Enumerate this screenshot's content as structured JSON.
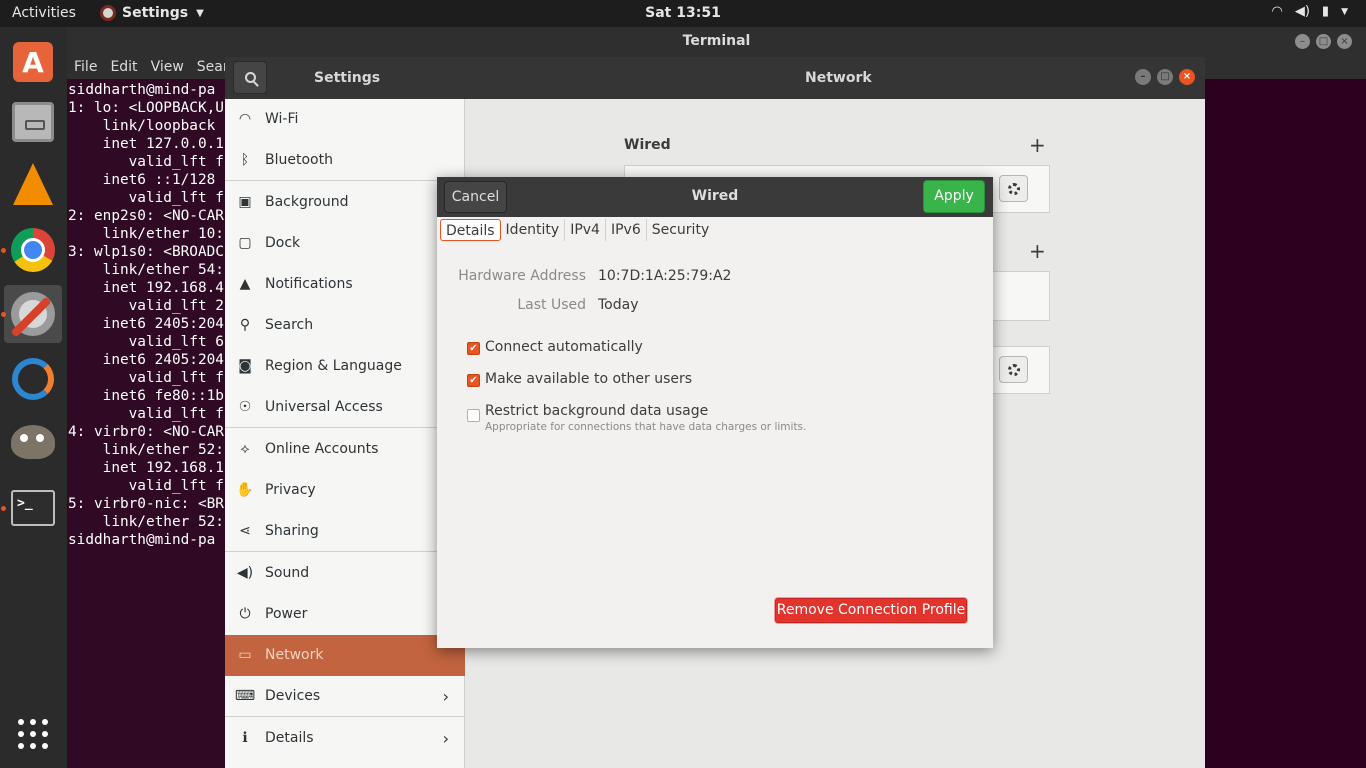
{
  "topbar": {
    "activities": "Activities",
    "app_menu": "Settings",
    "clock": "Sat 13:51",
    "icons": [
      "wifi-icon",
      "volume-icon",
      "battery-icon",
      "power-menu-icon"
    ]
  },
  "dock": {
    "apps": [
      "ubuntu-software",
      "files",
      "vlc",
      "chrome",
      "settings",
      "ring",
      "gimp",
      "terminal",
      "show-applications"
    ]
  },
  "terminal": {
    "title": "Terminal",
    "menu": [
      "File",
      "Edit",
      "View",
      "Searc"
    ],
    "lines": [
      "siddharth@mind-pa",
      "1: lo: <LOOPBACK,U",
      "    link/loopback",
      "    inet 127.0.0.1",
      "       valid_lft f",
      "    inet6 ::1/128",
      "       valid_lft f",
      "2: enp2s0: <NO-CAR",
      "    link/ether 10:",
      "3: wlp1s0: <BROADC",
      "    link/ether 54:",
      "    inet 192.168.4",
      "       valid_lft 2",
      "    inet6 2405:204",
      "       valid_lft 6",
      "    inet6 2405:204",
      "       valid_lft f",
      "    inet6 fe80::1b",
      "       valid_lft f",
      "4: virbr0: <NO-CAR",
      "    link/ether 52:",
      "    inet 192.168.1",
      "       valid_lft f",
      "5: virbr0-nic: <BR",
      "    link/ether 52:",
      "siddharth@mind-pa"
    ]
  },
  "settings": {
    "title_left": "Settings",
    "title_right": "Network",
    "sidebar": [
      {
        "label": "Wi-Fi",
        "icon": "wifi-icon"
      },
      {
        "label": "Bluetooth",
        "icon": "bluetooth-icon"
      },
      {
        "label": "Background",
        "icon": "background-icon"
      },
      {
        "label": "Dock",
        "icon": "dock-icon"
      },
      {
        "label": "Notifications",
        "icon": "bell-icon"
      },
      {
        "label": "Search",
        "icon": "search-icon"
      },
      {
        "label": "Region & Language",
        "icon": "camera-icon"
      },
      {
        "label": "Universal Access",
        "icon": "accessibility-icon"
      },
      {
        "label": "Online Accounts",
        "icon": "online-accounts-icon"
      },
      {
        "label": "Privacy",
        "icon": "hand-icon"
      },
      {
        "label": "Sharing",
        "icon": "share-icon"
      },
      {
        "label": "Sound",
        "icon": "speaker-icon"
      },
      {
        "label": "Power",
        "icon": "power-plug-icon"
      },
      {
        "label": "Network",
        "icon": "network-icon"
      },
      {
        "label": "Devices",
        "icon": "devices-icon"
      },
      {
        "label": "Details",
        "icon": "info-icon"
      }
    ],
    "network": {
      "wired_heading": "Wired"
    }
  },
  "dialog": {
    "title": "Wired",
    "cancel": "Cancel",
    "apply": "Apply",
    "tabs": [
      "Details",
      "Identity",
      "IPv4",
      "IPv6",
      "Security"
    ],
    "active_tab": "Details",
    "hardware_address_label": "Hardware Address",
    "hardware_address": "10:7D:1A:25:79:A2",
    "last_used_label": "Last Used",
    "last_used": "Today",
    "connect_auto": {
      "label": "Connect automatically",
      "checked": true
    },
    "available_all": {
      "label": "Make available to other users",
      "checked": true
    },
    "restrict_bg": {
      "label": "Restrict background data usage",
      "sublabel": "Appropriate for connections that have data charges or limits.",
      "checked": false
    },
    "remove": "Remove Connection Profile"
  },
  "colors": {
    "accent": "#e95420",
    "apply_green": "#38b44a",
    "remove_red": "#e3332d",
    "terminal_bg": "#300a24"
  }
}
